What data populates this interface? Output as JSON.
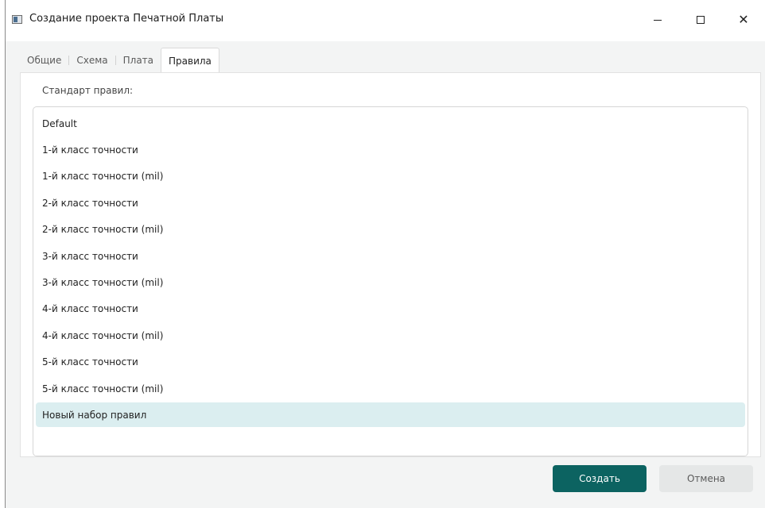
{
  "window": {
    "title": "Создание проекта Печатной Платы",
    "controls": {
      "minimize": "—",
      "maximize": "□",
      "close": "✕"
    }
  },
  "tabs": [
    {
      "label": "Общие",
      "active": false
    },
    {
      "label": "Схема",
      "active": false
    },
    {
      "label": "Плата",
      "active": false
    },
    {
      "label": "Правила",
      "active": true
    }
  ],
  "panel": {
    "label": "Стандарт правил:",
    "items": [
      {
        "label": "Default",
        "selected": false
      },
      {
        "label": "1-й класс точности",
        "selected": false
      },
      {
        "label": "1-й класс точности (mil)",
        "selected": false
      },
      {
        "label": "2-й класс точности",
        "selected": false
      },
      {
        "label": "2-й класс точности (mil)",
        "selected": false
      },
      {
        "label": "3-й класс точности",
        "selected": false
      },
      {
        "label": "3-й класс точности (mil)",
        "selected": false
      },
      {
        "label": "4-й класс точности",
        "selected": false
      },
      {
        "label": "4-й класс точности (mil)",
        "selected": false
      },
      {
        "label": "5-й класс точности",
        "selected": false
      },
      {
        "label": "5-й класс точности (mil)",
        "selected": false
      },
      {
        "label": "Новый набор правил",
        "selected": true
      }
    ]
  },
  "buttons": {
    "create": "Создать",
    "cancel": "Отмена"
  },
  "colors": {
    "accent": "#0c6361",
    "selection": "#dbeef0",
    "cancel_bg": "#e5e7e7"
  }
}
